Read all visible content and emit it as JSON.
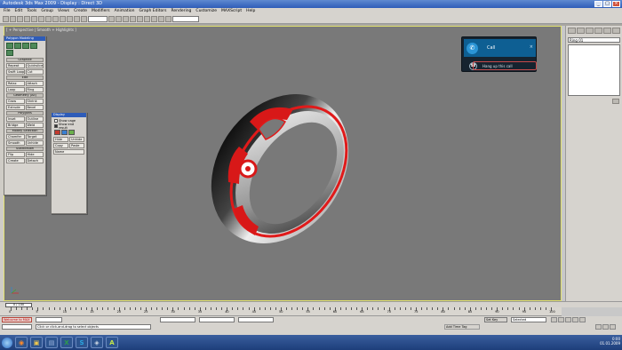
{
  "window": {
    "title": "Autodesk 3ds Max 2009 - Display : Direct 3D"
  },
  "menu": [
    "File",
    "Edit",
    "Tools",
    "Group",
    "Views",
    "Create",
    "Modifiers",
    "Animation",
    "Graph Editors",
    "Rendering",
    "Customize",
    "MAXScript",
    "Help"
  ],
  "viewport": {
    "label": "[ + Perspective | Smooth + Highlights ]"
  },
  "graphite_panel": {
    "title": "Polygon Modeling",
    "rollouts": [
      "Graphite",
      "Edit",
      "Geometry (All)",
      "Polygons",
      "Modify Selection",
      "Subdivision"
    ],
    "rows": [
      [
        "Repeat",
        "Quickslice"
      ],
      [
        "Swift Loop",
        "Cut"
      ],
      [
        "Relax",
        "Attach"
      ],
      [
        "Loop",
        "Ring"
      ],
      [
        "Grow",
        "Shrink"
      ],
      [
        "Extrude",
        "Bevel"
      ],
      [
        "Inset",
        "Outline"
      ],
      [
        "Bridge",
        "Weld"
      ],
      [
        "Chamfer",
        "Target"
      ],
      [
        "Smooth",
        "Unhide"
      ],
      [
        "Flip",
        "Hide"
      ],
      [
        "Create",
        "Detach"
      ]
    ]
  },
  "sub_panel": {
    "title": "Display",
    "checkboxes": [
      {
        "label": "Show cage",
        "checked": false
      },
      {
        "label": "Show end result",
        "checked": true
      }
    ],
    "swatch_colors": [
      "#c23a2e",
      "#3a7fd0",
      "#6ab04c"
    ],
    "buttons": [
      "Hide",
      "Unhide",
      "Copy",
      "Paste",
      "Name"
    ]
  },
  "skype": {
    "call_label": "Call",
    "close_glyph": "×",
    "hangup_label": "Hang up this call"
  },
  "command_panel": {
    "name_field": "Ring 01"
  },
  "time_slider": {
    "label": "0 / 100",
    "current_frame": 0,
    "total_frames": 100
  },
  "ruler": {
    "labels": [
      "0",
      "5",
      "10",
      "15",
      "20",
      "25",
      "30",
      "35",
      "40",
      "45",
      "50",
      "55",
      "60",
      "65",
      "70",
      "75",
      "80",
      "85",
      "90",
      "95",
      "100"
    ]
  },
  "status": {
    "script_box": "Welcome to MAX",
    "prompt": "Click or click-and-drag to select objects",
    "add_time_tag": "Add Time Tag",
    "set_key": "Set Key",
    "key_filter": "Selected"
  },
  "taskbar": {
    "apps": [
      {
        "name": "firefox",
        "glyph": "◉",
        "color": "#ff8a2a"
      },
      {
        "name": "explorer",
        "glyph": "▣",
        "color": "#f2c94c"
      },
      {
        "name": "save",
        "glyph": "▤",
        "color": "#9fb7e0"
      },
      {
        "name": "excel",
        "glyph": "X",
        "color": "#2e9d4a"
      },
      {
        "name": "skype",
        "glyph": "S",
        "color": "#2aa6e0"
      },
      {
        "name": "3dsmax",
        "glyph": "◈",
        "color": "#cfd8e4"
      },
      {
        "name": "acrobat",
        "glyph": "A",
        "color": "#c4e64a"
      }
    ],
    "time": "0:00",
    "date": "01.01.2009"
  },
  "colors": {
    "ring_accent": "#e01a1a",
    "viewport_bg": "#797979",
    "active_border": "#e1e16f"
  }
}
